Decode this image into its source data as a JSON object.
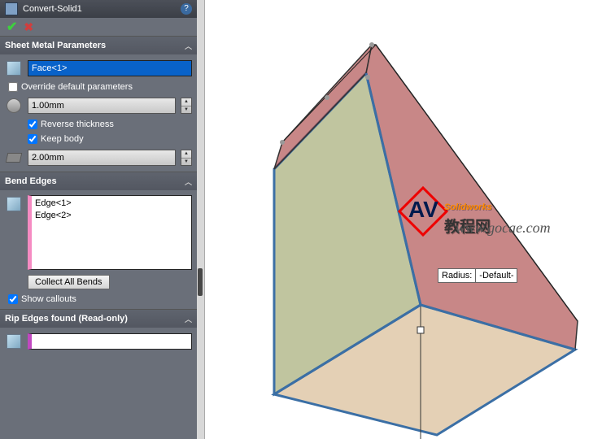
{
  "header": {
    "title": "Convert-Solid1"
  },
  "sheet": {
    "title": "Sheet Metal Parameters",
    "face": "Face<1>",
    "override": "Override default parameters",
    "thickness": "1.00mm",
    "reverse": "Reverse thickness",
    "keep": "Keep body",
    "bend_radius": "2.00mm"
  },
  "bend": {
    "title": "Bend Edges",
    "edges": [
      "Edge<1>",
      "Edge<2>"
    ],
    "collect": "Collect All Bends",
    "show": "Show callouts"
  },
  "rip": {
    "title": "Rip Edges found (Read-only)"
  },
  "callout": {
    "label": "Radius:",
    "value": "-Default-"
  },
  "watermark": {
    "brand": "Solidworks",
    "suffix": "教程网",
    "url": "www.gocae.com"
  }
}
